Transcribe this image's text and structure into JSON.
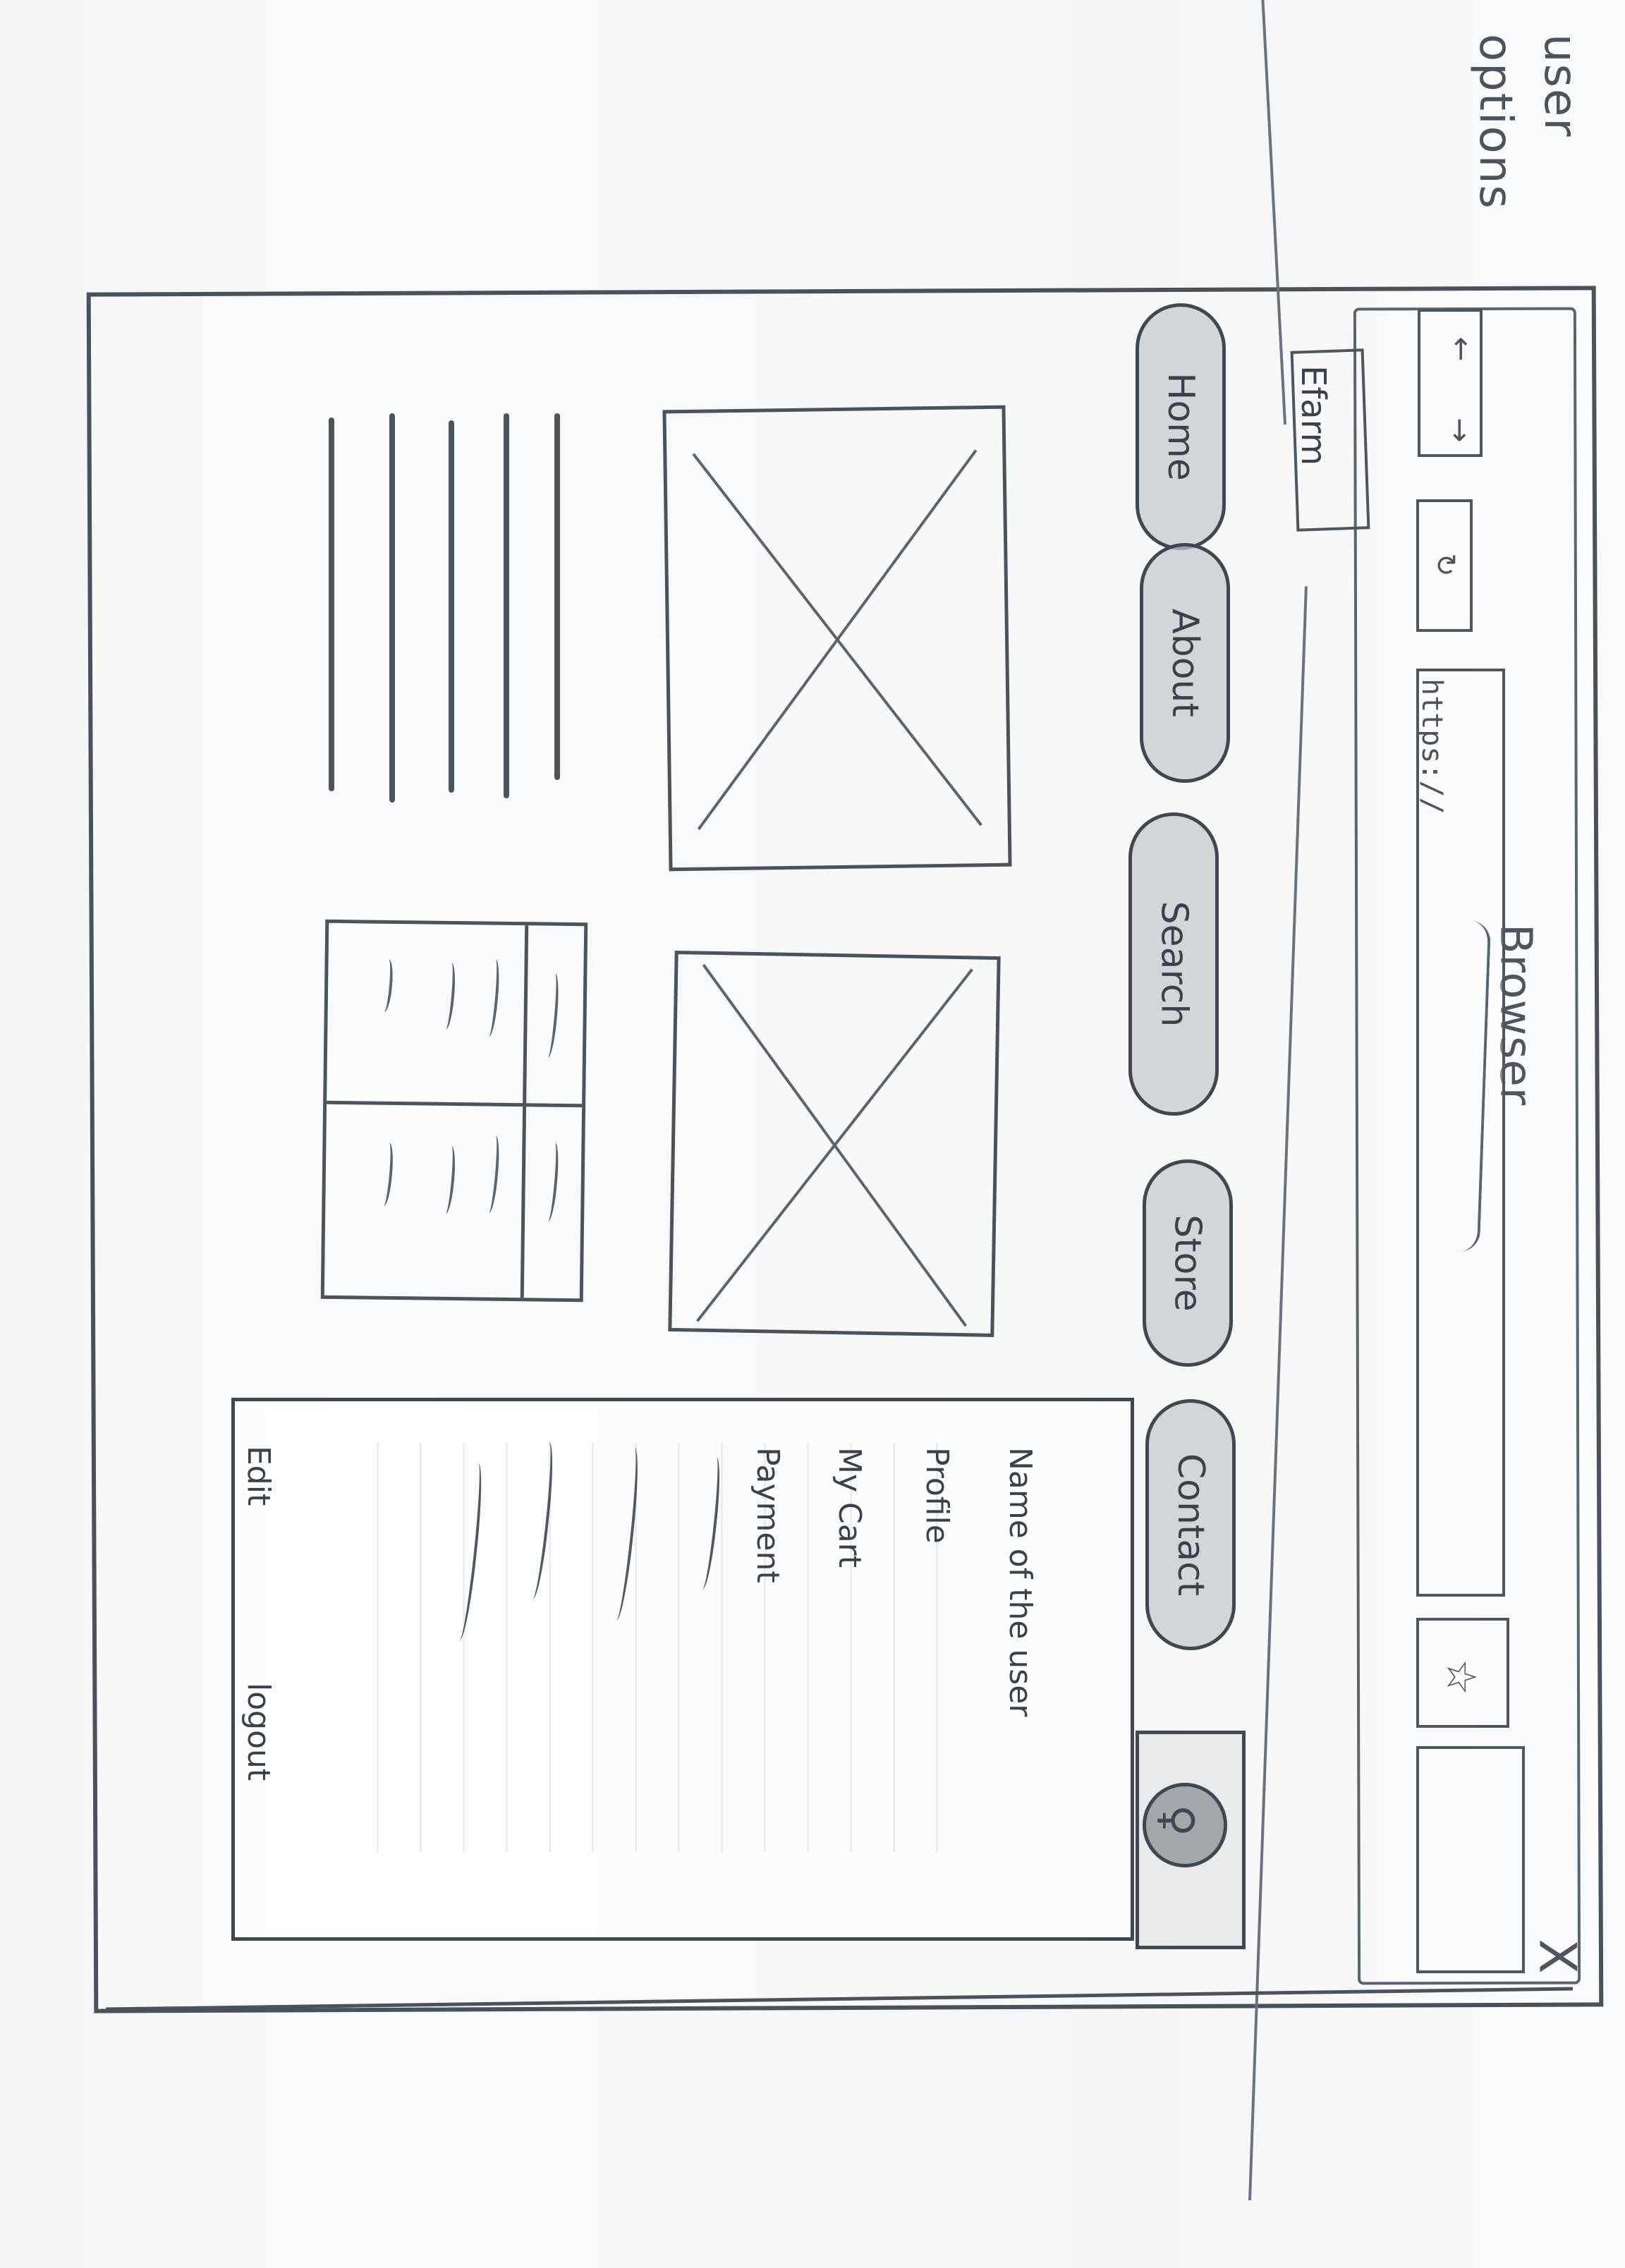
{
  "note": {
    "line_1": "user",
    "line_2": "options"
  },
  "browser": {
    "title": "Browser",
    "close_symbol": "X",
    "url": "https://",
    "brand": "Efarm"
  },
  "nav": {
    "home": "Home",
    "about": "About",
    "search": "Search",
    "store": "Store",
    "contact": "Contact"
  },
  "user_menu": {
    "name": "Name of the user",
    "profile": "Profile",
    "cart": "My Cart",
    "payment": "Payment",
    "edit": "Edit",
    "logout": "logout"
  },
  "icons": {
    "back": "←",
    "forward": "→",
    "refresh": "↻",
    "star": "☆",
    "user": "♀",
    "search": "🔍"
  }
}
